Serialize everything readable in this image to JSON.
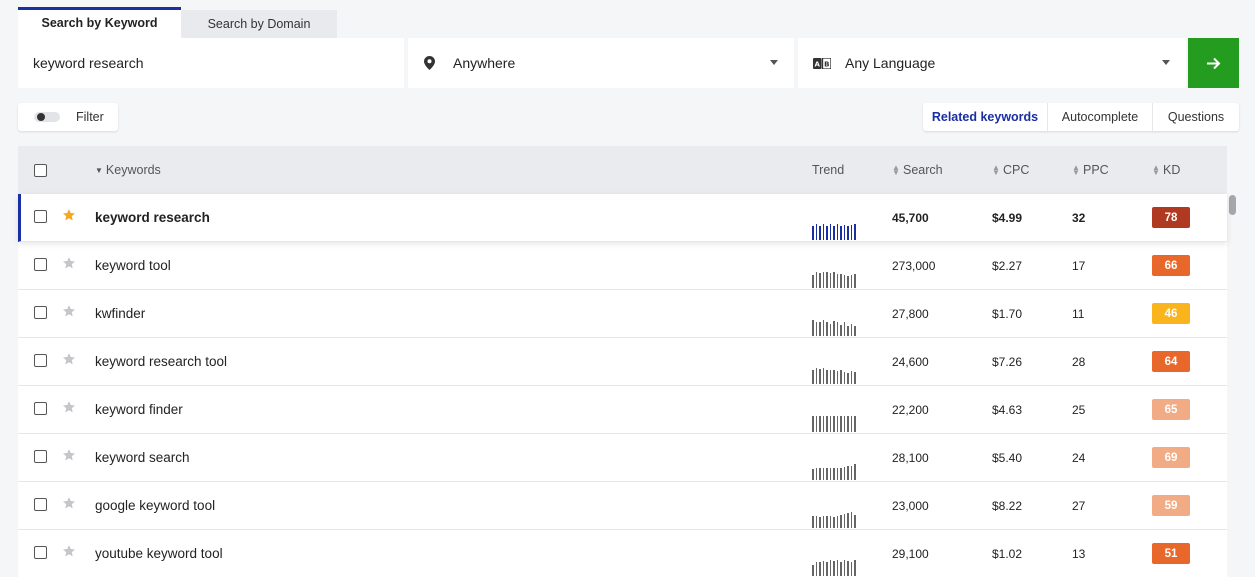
{
  "search_tabs": [
    {
      "label": "Search by Keyword",
      "active": true
    },
    {
      "label": "Search by Domain",
      "active": false
    }
  ],
  "search": {
    "keyword_value": "keyword research",
    "location": "Anywhere",
    "language": "Any Language",
    "go_icon": "arrow-right-icon"
  },
  "filter": {
    "label": "Filter"
  },
  "keyword_tabs": [
    {
      "label": "Related keywords",
      "active": true
    },
    {
      "label": "Autocomplete",
      "active": false
    },
    {
      "label": "Questions",
      "active": false
    }
  ],
  "table": {
    "columns": {
      "keywords": "Keywords",
      "trend": "Trend",
      "search": "Search",
      "cpc": "CPC",
      "ppc": "PPC",
      "kd": "KD"
    },
    "rows": [
      {
        "keyword": "keyword research",
        "starred": true,
        "search": "45,700",
        "cpc": "$4.99",
        "ppc": "32",
        "kd": "78",
        "kd_color": "#b03a21",
        "trend": [
          0.9,
          1,
          0.9,
          1,
          0.85,
          1,
          0.9,
          1,
          0.85,
          0.95,
          0.85,
          0.95,
          1
        ]
      },
      {
        "keyword": "keyword tool",
        "starred": false,
        "search": "273,000",
        "cpc": "$2.27",
        "ppc": "17",
        "kd": "66",
        "kd_color": "#e8672a",
        "trend": [
          0.8,
          1,
          0.95,
          1,
          1,
          0.95,
          1,
          0.9,
          0.85,
          0.8,
          0.75,
          0.8,
          0.85
        ]
      },
      {
        "keyword": "kwfinder",
        "starred": false,
        "search": "27,800",
        "cpc": "$1.70",
        "ppc": "11",
        "kd": "46",
        "kd_color": "#fab41e",
        "trend": [
          1,
          0.9,
          0.85,
          1,
          0.9,
          0.75,
          0.95,
          0.85,
          0.7,
          0.9,
          0.6,
          0.75,
          0.6
        ]
      },
      {
        "keyword": "keyword research tool",
        "starred": false,
        "search": "24,600",
        "cpc": "$7.26",
        "ppc": "28",
        "kd": "64",
        "kd_color": "#e8672a",
        "trend": [
          0.85,
          1,
          0.95,
          1,
          0.9,
          0.85,
          0.9,
          0.8,
          0.85,
          0.75,
          0.7,
          0.8,
          0.75
        ]
      },
      {
        "keyword": "keyword finder",
        "starred": false,
        "search": "22,200",
        "cpc": "$4.63",
        "ppc": "25",
        "kd": "65",
        "kd_color": "#f2ac85",
        "trend": [
          1,
          1,
          1,
          1,
          1,
          1,
          1,
          1,
          1,
          1,
          1,
          1,
          1
        ]
      },
      {
        "keyword": "keyword search",
        "starred": false,
        "search": "28,100",
        "cpc": "$5.40",
        "ppc": "24",
        "kd": "69",
        "kd_color": "#f2ac85",
        "trend": [
          0.7,
          0.75,
          0.75,
          0.75,
          0.75,
          0.75,
          0.75,
          0.75,
          0.75,
          0.8,
          0.85,
          0.9,
          1
        ]
      },
      {
        "keyword": "google keyword tool",
        "starred": false,
        "search": "23,000",
        "cpc": "$8.22",
        "ppc": "27",
        "kd": "59",
        "kd_color": "#f2ac85",
        "trend": [
          0.75,
          0.75,
          0.7,
          0.75,
          0.75,
          0.75,
          0.7,
          0.75,
          0.8,
          0.85,
          0.95,
          1,
          0.8
        ]
      },
      {
        "keyword": "youtube keyword tool",
        "starred": false,
        "search": "29,100",
        "cpc": "$1.02",
        "ppc": "13",
        "kd": "51",
        "kd_color": "#e8672a",
        "trend": [
          0.7,
          0.85,
          0.9,
          0.95,
          0.9,
          1,
          0.95,
          1,
          0.9,
          1,
          0.95,
          0.9,
          1
        ]
      }
    ]
  }
}
